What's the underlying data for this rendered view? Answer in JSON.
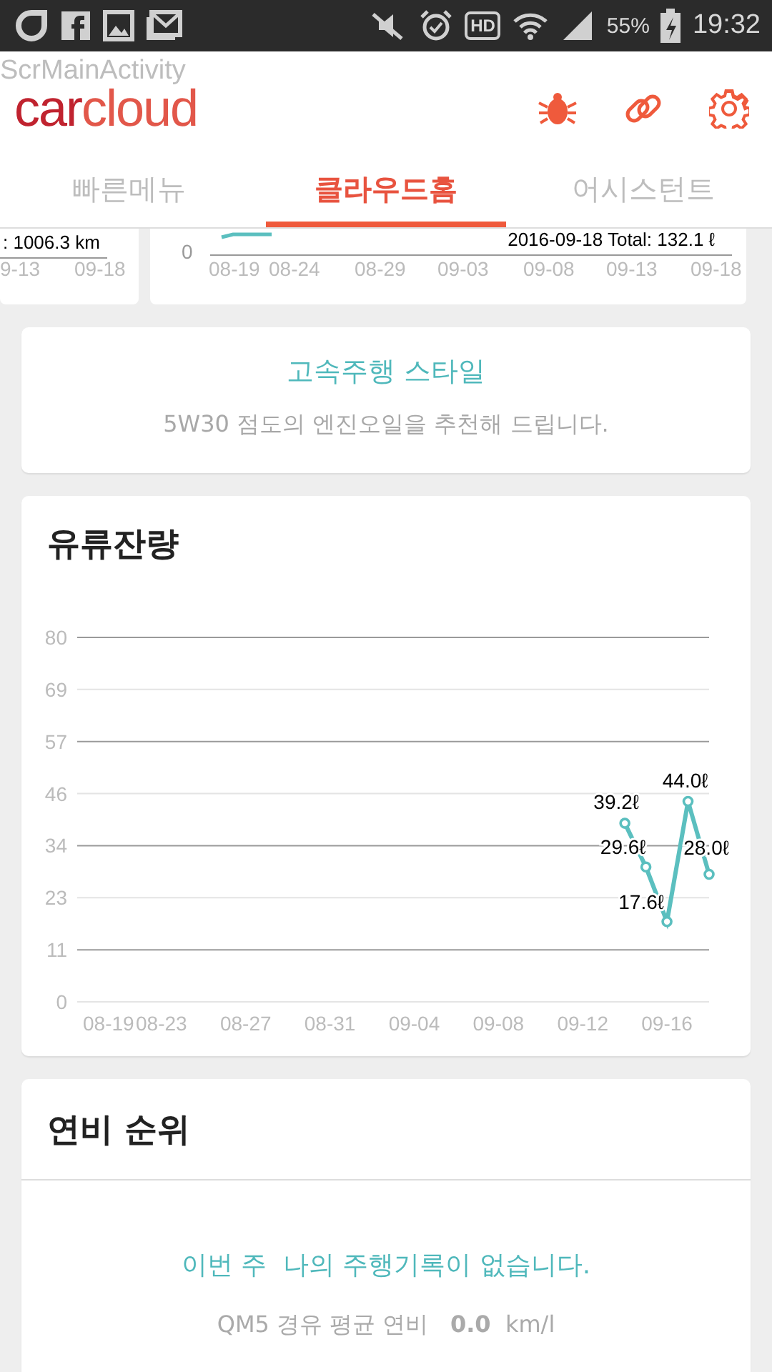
{
  "status_bar": {
    "hd_badge": "HD",
    "battery": "55%",
    "time": "19:32"
  },
  "header": {
    "activity_label": "ScrMainActivity",
    "logo": {
      "part_1": "car",
      "part_2": "cloud"
    }
  },
  "tabs": [
    {
      "label": "빠른메뉴",
      "selected": false
    },
    {
      "label": "클라우드홈",
      "selected": true
    },
    {
      "label": "어시스턴트",
      "selected": false
    }
  ],
  "partial_cards": {
    "left": {
      "reading": ": 1006.3 km",
      "x_labels": [
        "9-13",
        "09-18"
      ]
    },
    "right": {
      "y_label": "0",
      "annotation": "2016-09-18 Total: 132.1 ℓ",
      "x_labels": [
        "08-19",
        "08-24",
        "08-29",
        "09-03",
        "09-08",
        "09-13",
        "09-18"
      ]
    }
  },
  "style_card": {
    "title": "고속주행 스타일",
    "message": "5W30 점도의 엔진오일을 추천해 드립니다."
  },
  "fuel_card": {
    "title": "유류잔량",
    "chart_data": {
      "type": "line",
      "categories": [
        "08-19",
        null,
        null,
        null,
        "08-23",
        null,
        null,
        null,
        "08-27",
        null,
        null,
        null,
        "08-31",
        null,
        null,
        null,
        "09-04",
        null,
        null,
        null,
        "09-08",
        null,
        null,
        null,
        "09-12",
        null,
        null,
        null,
        "09-16",
        null,
        null
      ],
      "grid": true,
      "series": [
        {
          "color": "#5bbfbf",
          "marker": "circle",
          "values": [
            null,
            null,
            null,
            null,
            null,
            null,
            null,
            null,
            null,
            null,
            null,
            null,
            null,
            null,
            null,
            null,
            null,
            null,
            null,
            null,
            null,
            null,
            null,
            null,
            null,
            null,
            39.2,
            29.6,
            17.6,
            44.0,
            28.0
          ]
        }
      ],
      "ylim": [
        0,
        80
      ],
      "yticks": [
        {
          "value": 0,
          "label": "0"
        },
        {
          "value": 11.43,
          "label": "11"
        },
        {
          "value": 22.86,
          "label": "23"
        },
        {
          "value": 34.29,
          "label": "34"
        },
        {
          "value": 45.71,
          "label": "46"
        },
        {
          "value": 57.14,
          "label": "57"
        },
        {
          "value": 68.57,
          "label": "69"
        },
        {
          "value": 80,
          "label": "80"
        }
      ],
      "value_labels": [
        "39.2ℓ",
        "29.6ℓ",
        "17.6ℓ",
        "44.0ℓ",
        "28.0ℓ"
      ]
    }
  },
  "ranking_card": {
    "title": "연비 순위",
    "message": "이번 주  나의 주행기록이 없습니다.",
    "average": "QM5 경유 평균 연비   **0.0**  km/l"
  }
}
